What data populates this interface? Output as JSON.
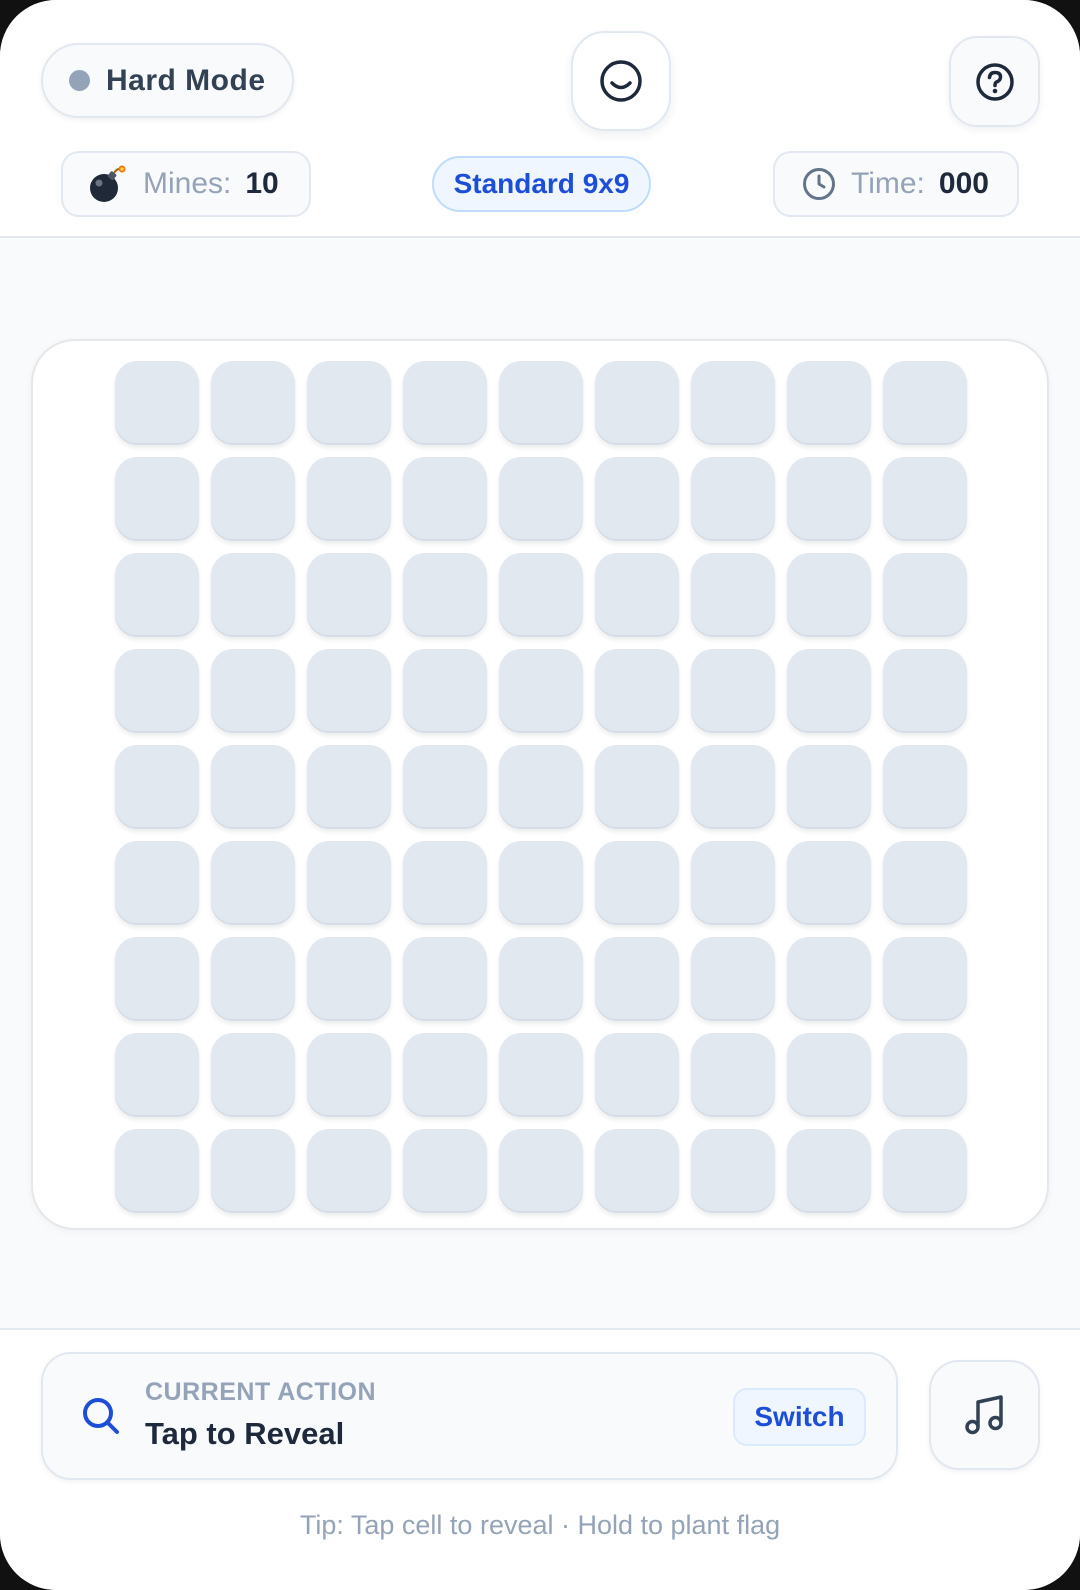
{
  "header": {
    "mode_label": "Hard Mode",
    "mode_dot_color": "#94a3b8",
    "face_icon": "smiley-face-icon",
    "help_icon": "question-circle-icon",
    "mines": {
      "icon": "bomb-icon",
      "label": "Mines:",
      "value": "10"
    },
    "preset_label": "Standard 9x9",
    "time": {
      "icon": "clock-icon",
      "label": "Time:",
      "value": "000"
    }
  },
  "board": {
    "rows": 9,
    "cols": 9,
    "cell_state": "hidden",
    "cell_color": "#e2e8f0"
  },
  "footer": {
    "action_icon": "search-icon",
    "action_caption": "CURRENT ACTION",
    "action_text": "Tap to Reveal",
    "switch_label": "Switch",
    "music_icon": "music-note-icon",
    "tip": "Tip: Tap cell to reveal · Hold to plant flag"
  },
  "colors": {
    "accent": "#1d4ed8",
    "text_dark": "#1e293b",
    "text_muted": "#94a3b8",
    "border": "#e2e8f0"
  }
}
